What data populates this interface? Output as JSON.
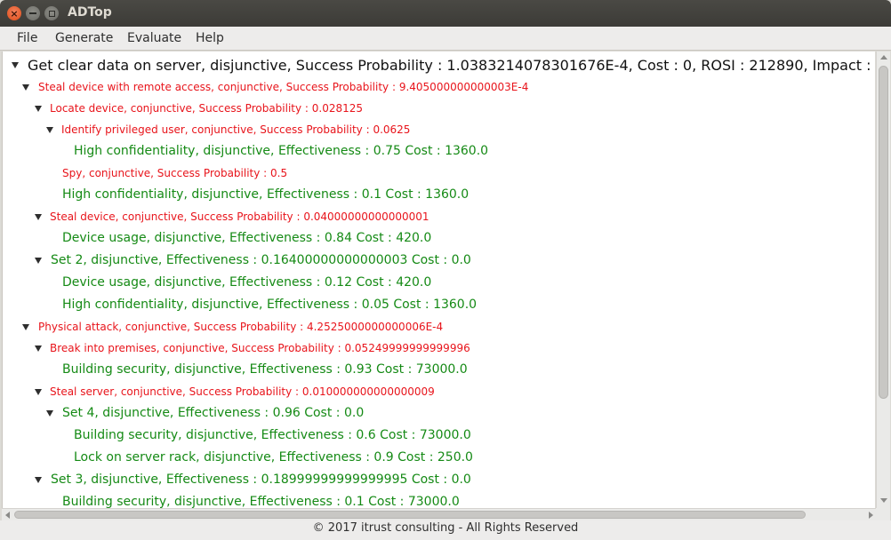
{
  "window": {
    "title": "ADTop",
    "controls": [
      "close-icon",
      "minimize-icon",
      "maximize-icon"
    ]
  },
  "menu": {
    "items": [
      "File",
      "Generate",
      "Evaluate",
      "Help"
    ]
  },
  "tree": {
    "nodes": [
      {
        "text": "Get clear data on server, disjunctive, Success Probability : 1.0383214078301676E-4, Cost : 0, ROSI : 212890, Impact :",
        "color": "black",
        "expanded": true
      },
      {
        "text": "Steal device with remote access, conjunctive, Success Probability : 9.405000000000003E-4",
        "color": "red",
        "expanded": true
      },
      {
        "text": "Locate device, conjunctive, Success Probability : 0.028125",
        "color": "red",
        "expanded": true
      },
      {
        "text": "Identify privileged user, conjunctive, Success Probability : 0.0625",
        "color": "red",
        "expanded": true
      },
      {
        "text": "High confidentiality, disjunctive, Effectiveness : 0.75 Cost : 1360.0",
        "color": "green",
        "expanded": false
      },
      {
        "text": "Spy, conjunctive, Success Probability : 0.5",
        "color": "red",
        "expanded": false
      },
      {
        "text": "High confidentiality, disjunctive, Effectiveness : 0.1 Cost : 1360.0",
        "color": "green",
        "expanded": false
      },
      {
        "text": "Steal device, conjunctive, Success Probability : 0.04000000000000001",
        "color": "red",
        "expanded": true
      },
      {
        "text": "Device usage, disjunctive, Effectiveness : 0.84 Cost : 420.0",
        "color": "green",
        "expanded": false
      },
      {
        "text": "Set 2, disjunctive, Effectiveness : 0.16400000000000003 Cost : 0.0",
        "color": "green",
        "expanded": true
      },
      {
        "text": "Device usage, disjunctive, Effectiveness : 0.12 Cost : 420.0",
        "color": "green",
        "expanded": false
      },
      {
        "text": "High confidentiality, disjunctive, Effectiveness : 0.05 Cost : 1360.0",
        "color": "green",
        "expanded": false
      },
      {
        "text": "Physical attack, conjunctive, Success Probability : 4.2525000000000006E-4",
        "color": "red",
        "expanded": true
      },
      {
        "text": "Break into premises, conjunctive, Success Probability : 0.05249999999999996",
        "color": "red",
        "expanded": true
      },
      {
        "text": "Building security, disjunctive, Effectiveness : 0.93 Cost : 73000.0",
        "color": "green",
        "expanded": false
      },
      {
        "text": "Steal server, conjunctive, Success Probability : 0.010000000000000009",
        "color": "red",
        "expanded": true
      },
      {
        "text": "Set 4, disjunctive, Effectiveness : 0.96 Cost : 0.0",
        "color": "green",
        "expanded": true
      },
      {
        "text": "Building security, disjunctive, Effectiveness : 0.6 Cost : 73000.0",
        "color": "green",
        "expanded": false
      },
      {
        "text": "Lock on server rack, disjunctive, Effectiveness : 0.9 Cost : 250.0",
        "color": "green",
        "expanded": false
      },
      {
        "text": "Set 3, disjunctive, Effectiveness : 0.18999999999999995 Cost : 0.0",
        "color": "green",
        "expanded": true
      },
      {
        "text": "Building security, disjunctive, Effectiveness : 0.1 Cost : 73000.0",
        "color": "green",
        "expanded": false
      }
    ]
  },
  "footer": {
    "text": "© 2017 itrust consulting - All Rights Reserved"
  },
  "colors": {
    "red": "#e8141b",
    "green": "#158a15",
    "black": "#111111",
    "titlebar": "#3c3b37"
  }
}
